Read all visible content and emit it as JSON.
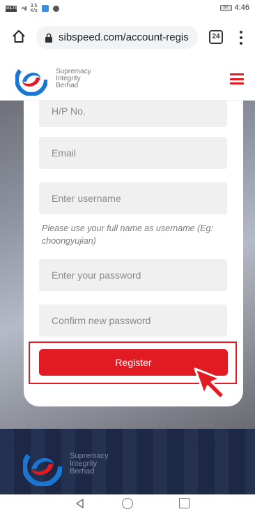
{
  "status_bar": {
    "sim_label": "VoLTE",
    "signal_text": "⁴⁶ıll",
    "speed": "3.5",
    "speed_unit": "K/s",
    "battery": "57",
    "time": "4:46"
  },
  "browser": {
    "url": "sibspeed.com/account-regis",
    "tab_count": "24"
  },
  "site": {
    "brand_line1": "Supremacy",
    "brand_line2": "Integrity",
    "brand_line3": "Berhad"
  },
  "form": {
    "phone_placeholder": "H/P No.",
    "email_placeholder": "Email",
    "username_placeholder": "Enter username",
    "username_hint": "Please use your full name as username (Eg: choongyujian)",
    "password_placeholder": "Enter your password",
    "confirm_placeholder": "Confirm new password",
    "register_label": "Register"
  },
  "footer": {
    "brand_line1": "Supremacy",
    "brand_line2": "Integrity",
    "brand_line3": "Berhad"
  },
  "colors": {
    "accent": "#e21b23",
    "footer_bg": "#1d2a4a",
    "logo_blue": "#1b76d1"
  },
  "icons": {
    "home": "home-icon",
    "lock": "lock-icon",
    "menu": "more-vert-icon",
    "hamburger": "hamburger-menu-icon",
    "back": "back-triangle-icon",
    "nav_home": "circle-home-icon",
    "recent": "square-recent-icon"
  }
}
